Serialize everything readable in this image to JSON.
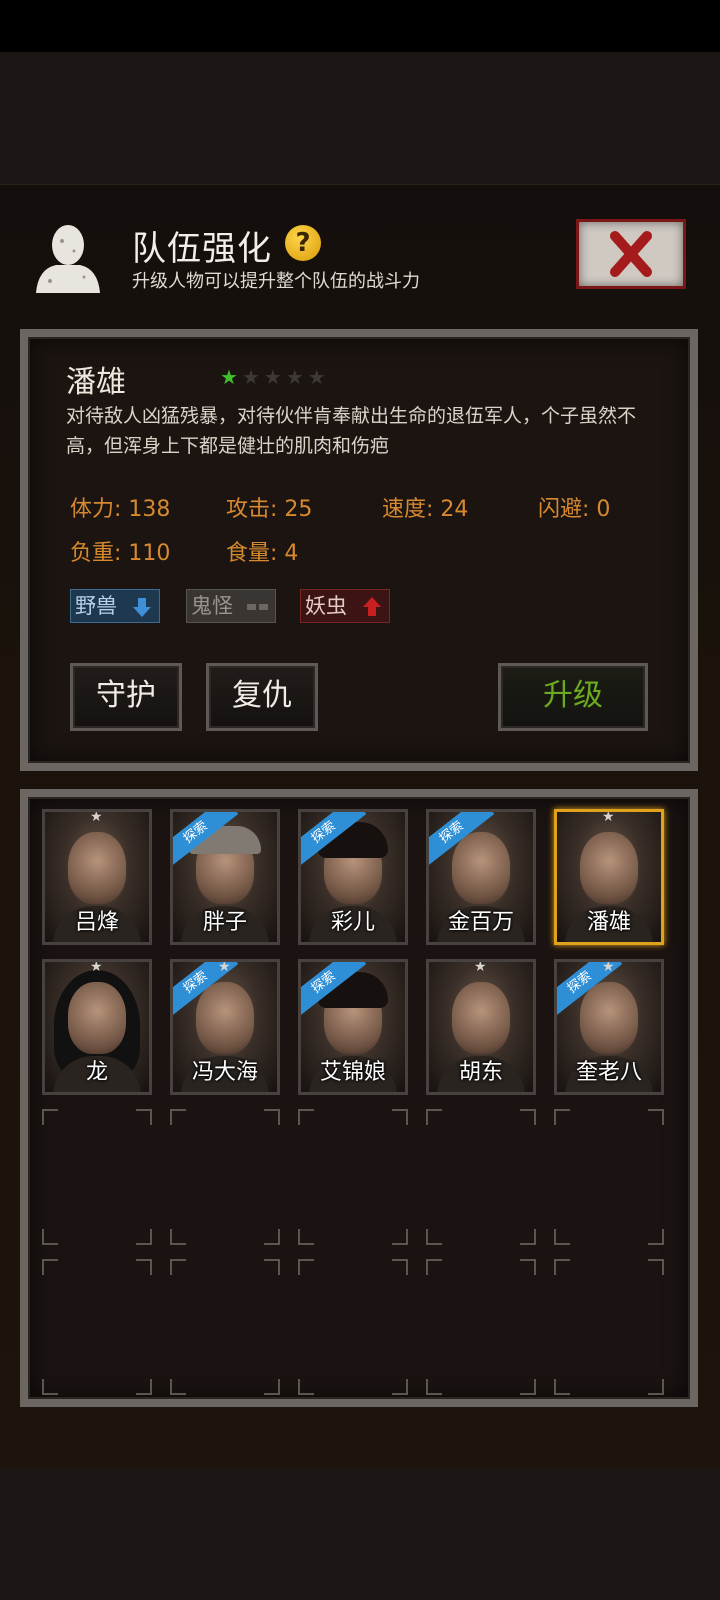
{
  "header": {
    "title": "队伍强化",
    "subtitle": "升级人物可以提升整个队伍的战斗力",
    "help_label": "?"
  },
  "character": {
    "name": "潘雄",
    "stars_filled": 1,
    "stars_total": 5,
    "description": "对待敌人凶猛残暴，对待伙伴肯奉献出生命的退伍军人，个子虽然不高，但浑身上下都是健壮的肌肉和伤疤",
    "stats": {
      "stamina": "体力: 138",
      "attack": "攻击: 25",
      "speed": "速度: 24",
      "dodge": "闪避: 0",
      "load": "负重: 110",
      "food": "食量: 4"
    },
    "affinities": [
      {
        "label": "野兽",
        "trend": "down",
        "color": "#3e8fd6"
      },
      {
        "label": "鬼怪",
        "trend": "neutral",
        "color": "#6d6763"
      },
      {
        "label": "妖虫",
        "trend": "up",
        "color": "#c82020"
      }
    ]
  },
  "actions": {
    "guard_label": "守护",
    "revenge_label": "复仇",
    "upgrade_label": "升级"
  },
  "explore_badge_label": "探索",
  "roster": [
    {
      "name": "吕烽",
      "star": true,
      "explore": false,
      "selected": false
    },
    {
      "name": "胖子",
      "star": false,
      "explore": true,
      "selected": false
    },
    {
      "name": "彩儿",
      "star": false,
      "explore": true,
      "selected": false
    },
    {
      "name": "金百万",
      "star": false,
      "explore": true,
      "selected": false
    },
    {
      "name": "潘雄",
      "star": true,
      "explore": false,
      "selected": true
    },
    {
      "name": "龙",
      "star": true,
      "explore": false,
      "selected": false
    },
    {
      "name": "冯大海",
      "star": true,
      "explore": true,
      "selected": false
    },
    {
      "name": "艾锦娘",
      "star": false,
      "explore": true,
      "selected": false
    },
    {
      "name": "胡东",
      "star": true,
      "explore": false,
      "selected": false
    },
    {
      "name": "奎老八",
      "star": true,
      "explore": true,
      "selected": false
    }
  ]
}
